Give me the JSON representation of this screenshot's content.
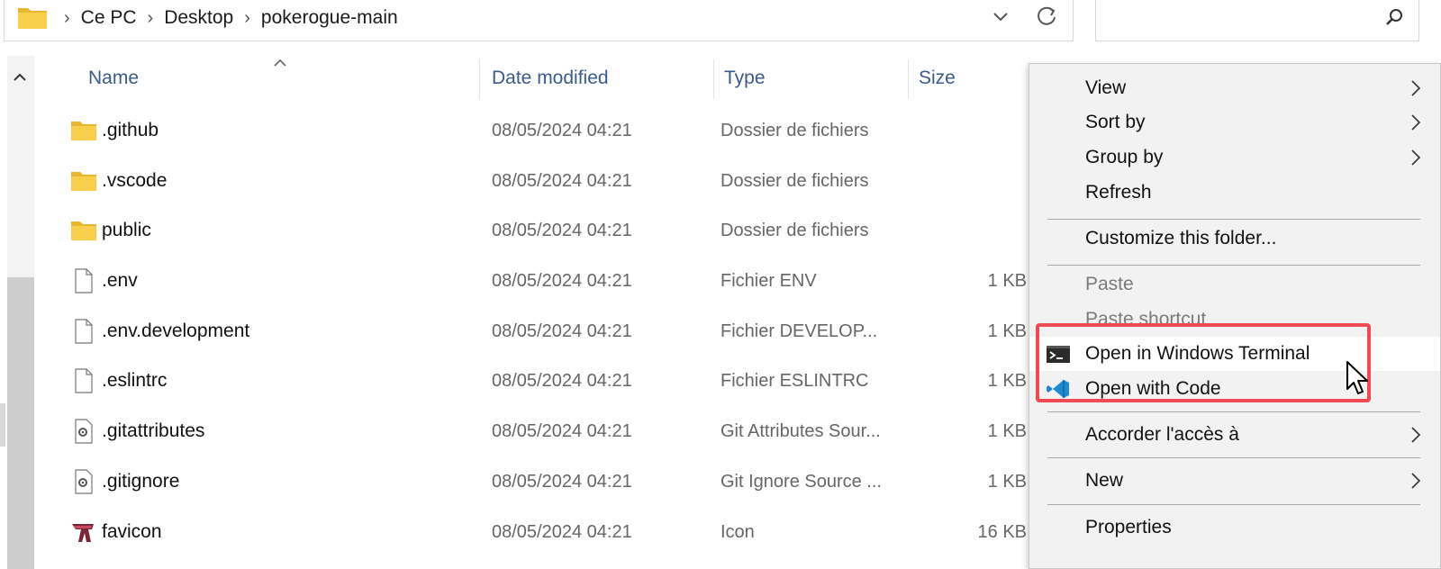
{
  "addressbar": {
    "crumbs": [
      "Ce PC",
      "Desktop",
      "pokerogue-main"
    ]
  },
  "columns": {
    "name": "Name",
    "date": "Date modified",
    "type": "Type",
    "size": "Size"
  },
  "files": [
    {
      "name": ".github",
      "date": "08/05/2024 04:21",
      "type": "Dossier de fichiers",
      "size": "",
      "icon": "folder-icon"
    },
    {
      "name": ".vscode",
      "date": "08/05/2024 04:21",
      "type": "Dossier de fichiers",
      "size": "",
      "icon": "folder-icon"
    },
    {
      "name": "public",
      "date": "08/05/2024 04:21",
      "type": "Dossier de fichiers",
      "size": "",
      "icon": "folder-icon"
    },
    {
      "name": ".env",
      "date": "08/05/2024 04:21",
      "type": "Fichier ENV",
      "size": "1 KB",
      "icon": "file-icon"
    },
    {
      "name": ".env.development",
      "date": "08/05/2024 04:21",
      "type": "Fichier DEVELOP...",
      "size": "1 KB",
      "icon": "file-icon"
    },
    {
      "name": ".eslintrc",
      "date": "08/05/2024 04:21",
      "type": "Fichier ESLINTRC",
      "size": "1 KB",
      "icon": "file-icon"
    },
    {
      "name": ".gitattributes",
      "date": "08/05/2024 04:21",
      "type": "Git Attributes Sour...",
      "size": "1 KB",
      "icon": "git-file-icon"
    },
    {
      "name": ".gitignore",
      "date": "08/05/2024 04:21",
      "type": "Git Ignore Source ...",
      "size": "1 KB",
      "icon": "git-file-icon"
    },
    {
      "name": "favicon",
      "date": "08/05/2024 04:21",
      "type": "Icon",
      "size": "16 KB",
      "icon": "favicon-icon"
    }
  ],
  "context_menu": {
    "view": "View",
    "sort_by": "Sort by",
    "group_by": "Group by",
    "refresh": "Refresh",
    "customize": "Customize this folder...",
    "paste": "Paste",
    "paste_shortcut": "Paste shortcut",
    "open_terminal": "Open in Windows Terminal",
    "open_code": "Open with Code",
    "grant_access": "Accorder l'accès à",
    "new": "New",
    "properties": "Properties"
  },
  "colors": {
    "highlight": "#ee4b55",
    "folder": "#f5c542",
    "header_text": "#3a5a8a",
    "vscode_blue": "#1f8ad2"
  }
}
